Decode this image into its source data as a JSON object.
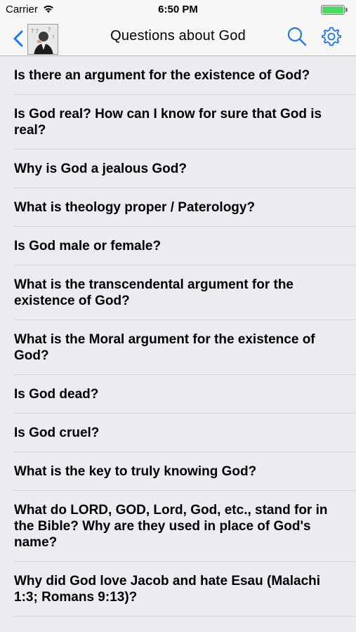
{
  "status_bar": {
    "carrier": "Carrier",
    "time": "6:50 PM",
    "battery_level": 1.0,
    "battery_color": "#4cd964"
  },
  "nav": {
    "back_icon": "chevron-left-icon",
    "avatar_icon": "thinking-person-icon",
    "title": "Questions about God",
    "search_icon": "search-icon",
    "settings_icon": "gear-icon",
    "accent_color": "#1e7ae6"
  },
  "questions": [
    "Is there an argument for the existence of God?",
    "Is God real? How can I know for sure that God is real?",
    "Why is God a jealous God?",
    "What is theology proper / Paterology?",
    "Is God male or female?",
    "What is the transcendental argument for the existence of God?",
    "What is the Moral argument for the existence of God?",
    "Is God dead?",
    "Is God cruel?",
    "What is the key to truly knowing God?",
    "What do LORD, GOD, Lord, God, etc., stand for in the Bible? Why are they used in place of God's name?",
    "Why did God love Jacob and hate Esau (Malachi 1:3; Romans 9:13)?"
  ]
}
